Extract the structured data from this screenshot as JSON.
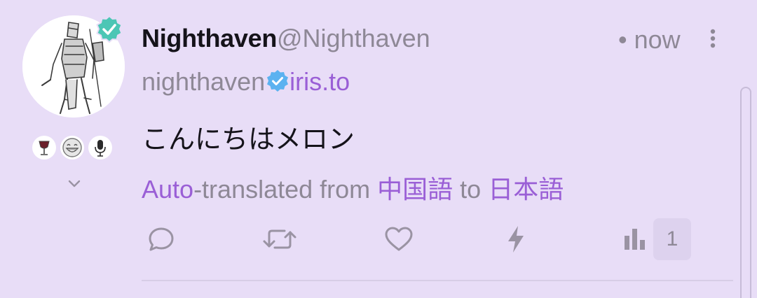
{
  "author": {
    "display_name": "Nighthaven",
    "handle": "@Nighthaven",
    "nip05_user": "nighthaven",
    "nip05_domain": "iris.to"
  },
  "post": {
    "time": "• now",
    "content": "こんにちはメロン"
  },
  "translation": {
    "auto": "Auto",
    "middle": "-translated from ",
    "source_language": "中国語",
    "to_word": " to ",
    "target_language": "日本語"
  },
  "stats": {
    "views_count": "1"
  },
  "icons": {
    "verified_avatar": "verified-badge-icon",
    "nip05_verified": "verified-check-icon",
    "reactions": [
      "wine-glass-icon",
      "grinning-face-icon",
      "microphone-icon"
    ],
    "expand": "chevron-down-icon",
    "more": "more-vertical-icon",
    "reply": "reply-icon",
    "repost": "repost-icon",
    "like": "heart-icon",
    "zap": "zap-icon",
    "stats": "stats-icon"
  },
  "colors": {
    "background": "#e8ddf7",
    "accent": "#9a5fd6",
    "verified_green": "#4cc6b5",
    "nip05_blue": "#5bb2f0",
    "muted": "#8e8896",
    "text": "#15131a"
  }
}
